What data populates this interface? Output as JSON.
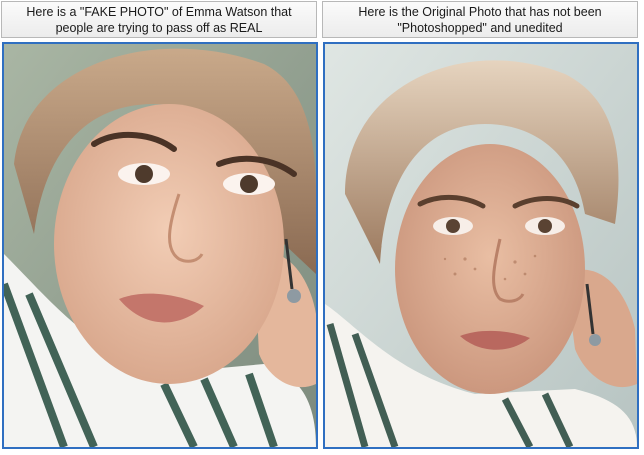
{
  "panels": [
    {
      "caption": "Here is a \"FAKE PHOTO\" of Emma Watson that people are trying to pass off as REAL",
      "image_alt": "Retouched portrait of a young woman with her hand behind her head, wearing a striped shirt"
    },
    {
      "caption": "Here is the Original Photo that has not been \"Photoshopped\" and unedited",
      "image_alt": "Unedited portrait of a young woman with freckles, hand behind her head, wearing a striped shirt"
    }
  ],
  "colors": {
    "frame_border": "#2f6fc1",
    "caption_border": "#b8b8b8"
  }
}
